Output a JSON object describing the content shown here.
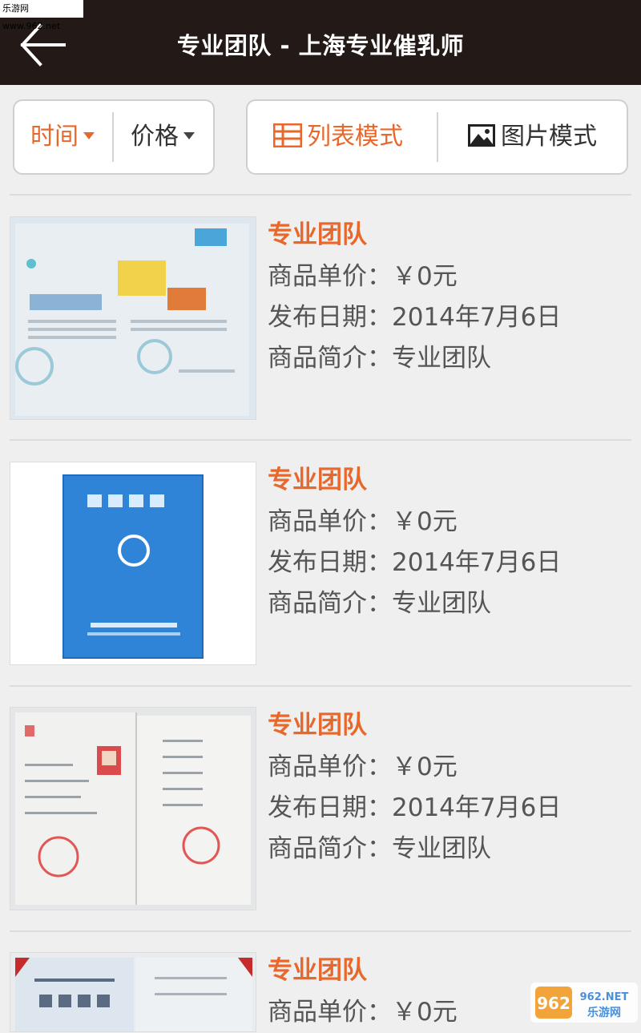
{
  "watermark_top": "乐游网 www.962.net",
  "header": {
    "title": "专业团队 - 上海专业催乳师"
  },
  "filters": {
    "time_label": "时间",
    "price_label": "价格"
  },
  "modes": {
    "list_label": "列表模式",
    "image_label": "图片模式"
  },
  "colors": {
    "accent": "#e8682b",
    "header_bg": "#231a17",
    "page_bg": "#efefef"
  },
  "items": [
    {
      "name": "专业团队",
      "price": "商品单价：￥0元",
      "date": "发布日期：2014年7月6日",
      "desc": "商品简介：专业团队",
      "image": "pampers-brochure-photo"
    },
    {
      "name": "专业团队",
      "price": "商品单价：￥0元",
      "date": "发布日期：2014年7月6日",
      "desc": "商品简介：专业团队",
      "image": "blue-certificate-photo"
    },
    {
      "name": "专业团队",
      "price": "商品单价：￥0元",
      "date": "发布日期：2014年7月6日",
      "desc": "商品简介：专业团队",
      "image": "open-certificate-photo"
    },
    {
      "name": "专业团队",
      "price": "商品单价：￥0元",
      "date": "",
      "desc": "",
      "image": "diploma-photo"
    }
  ],
  "watermark_bottom": {
    "top": "962.NET",
    "bottom": "乐游网"
  }
}
